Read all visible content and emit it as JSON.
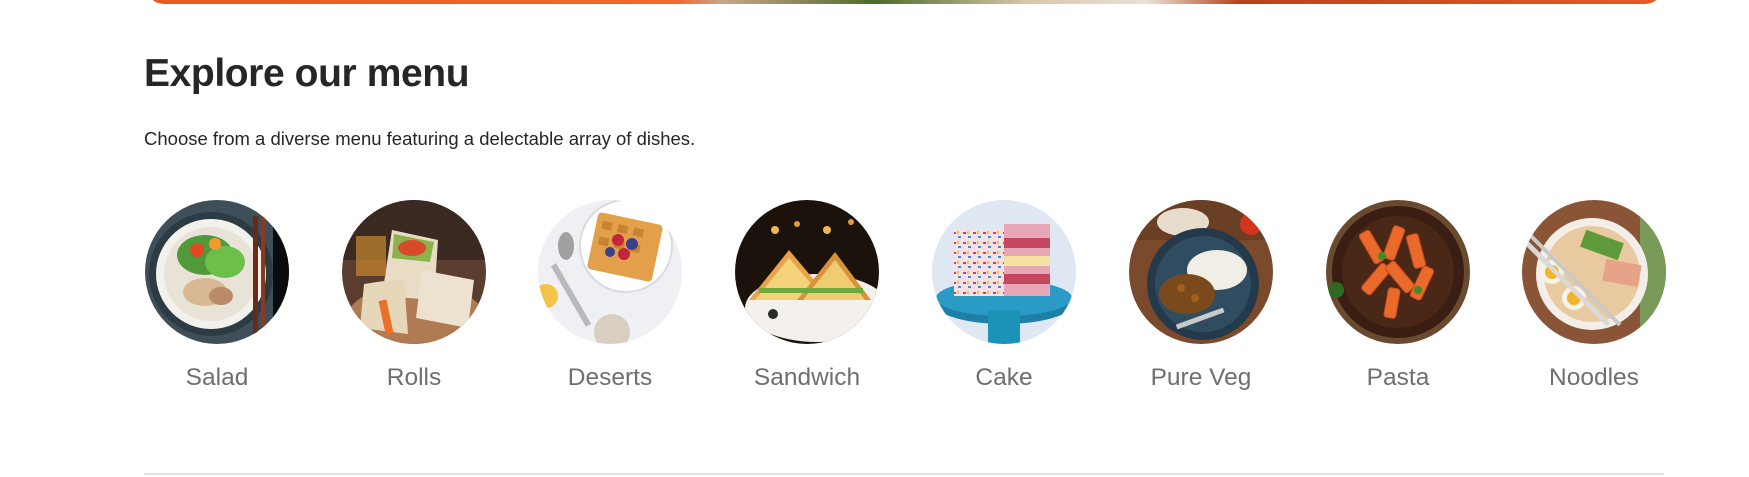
{
  "explore_menu": {
    "title": "Explore our menu",
    "subtitle": "Choose from a diverse menu featuring a delectable array of dishes.",
    "items": [
      {
        "label": "Salad",
        "icon": "salad-image"
      },
      {
        "label": "Rolls",
        "icon": "rolls-image"
      },
      {
        "label": "Deserts",
        "icon": "deserts-image"
      },
      {
        "label": "Sandwich",
        "icon": "sandwich-image"
      },
      {
        "label": "Cake",
        "icon": "cake-image"
      },
      {
        "label": "Pure Veg",
        "icon": "pure-veg-image"
      },
      {
        "label": "Pasta",
        "icon": "pasta-image"
      },
      {
        "label": "Noodles",
        "icon": "noodles-image"
      }
    ]
  },
  "colors": {
    "accent": "#e65a1f",
    "heading": "#262626",
    "label": "#6f6f6f",
    "divider": "#e2e2e2"
  }
}
